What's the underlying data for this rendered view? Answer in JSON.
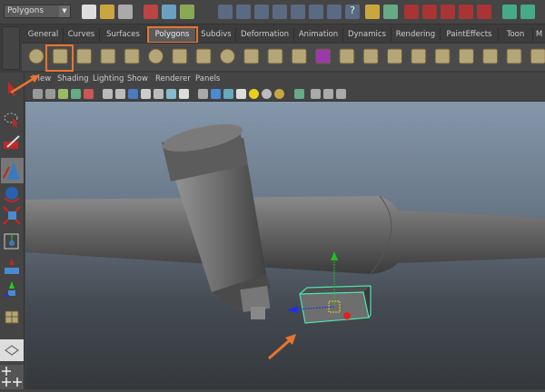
{
  "status_line": {
    "mode_selector": "Polygons"
  },
  "shelf": {
    "tabs": [
      {
        "label": "General"
      },
      {
        "label": "Curves"
      },
      {
        "label": "Surfaces"
      },
      {
        "label": "Polygons",
        "active": true
      },
      {
        "label": "Subdivs"
      },
      {
        "label": "Deformation"
      },
      {
        "label": "Animation"
      },
      {
        "label": "Dynamics"
      },
      {
        "label": "Rendering"
      },
      {
        "label": "PaintEffects"
      },
      {
        "label": "Toon"
      },
      {
        "label": "M"
      }
    ],
    "icons": [
      "poly-sphere-icon",
      "poly-cube-icon",
      "poly-cylinder-icon",
      "poly-cone-icon",
      "poly-plane-icon",
      "poly-torus-icon",
      "poly-pyramid-icon",
      "poly-pipe-icon",
      "poly-soccer-ball-icon",
      "combine-icon",
      "separate-icon",
      "smooth-icon",
      "sculpt-icon",
      "extrude-icon",
      "append-icon",
      "split-icon",
      "wedge-icon",
      "bevel-icon",
      "merge-icon",
      "cut-face-icon",
      "bridge-icon",
      "unfold-icon"
    ],
    "highlighted_icon": "poly-cube-icon"
  },
  "panel": {
    "menus": [
      "View",
      "Shading",
      "Lighting",
      "Show",
      "Renderer",
      "Panels"
    ]
  },
  "toolbox": [
    "select-tool-icon",
    "lasso-tool-icon",
    "paint-select-icon",
    "move-tool-icon",
    "rotate-tool-icon",
    "scale-tool-icon",
    "manipulator-icon",
    "soft-mod-icon",
    "last-tool-icon",
    "poly-cube-icon",
    "single-perspective-layout-icon",
    "four-view-layout-icon"
  ],
  "colors": {
    "accent_highlight": "#e8752e",
    "wireframe_selected": "#4fe3b0",
    "axis_x": "#e02020",
    "axis_y": "#20c020",
    "axis_z": "#2030e0"
  }
}
